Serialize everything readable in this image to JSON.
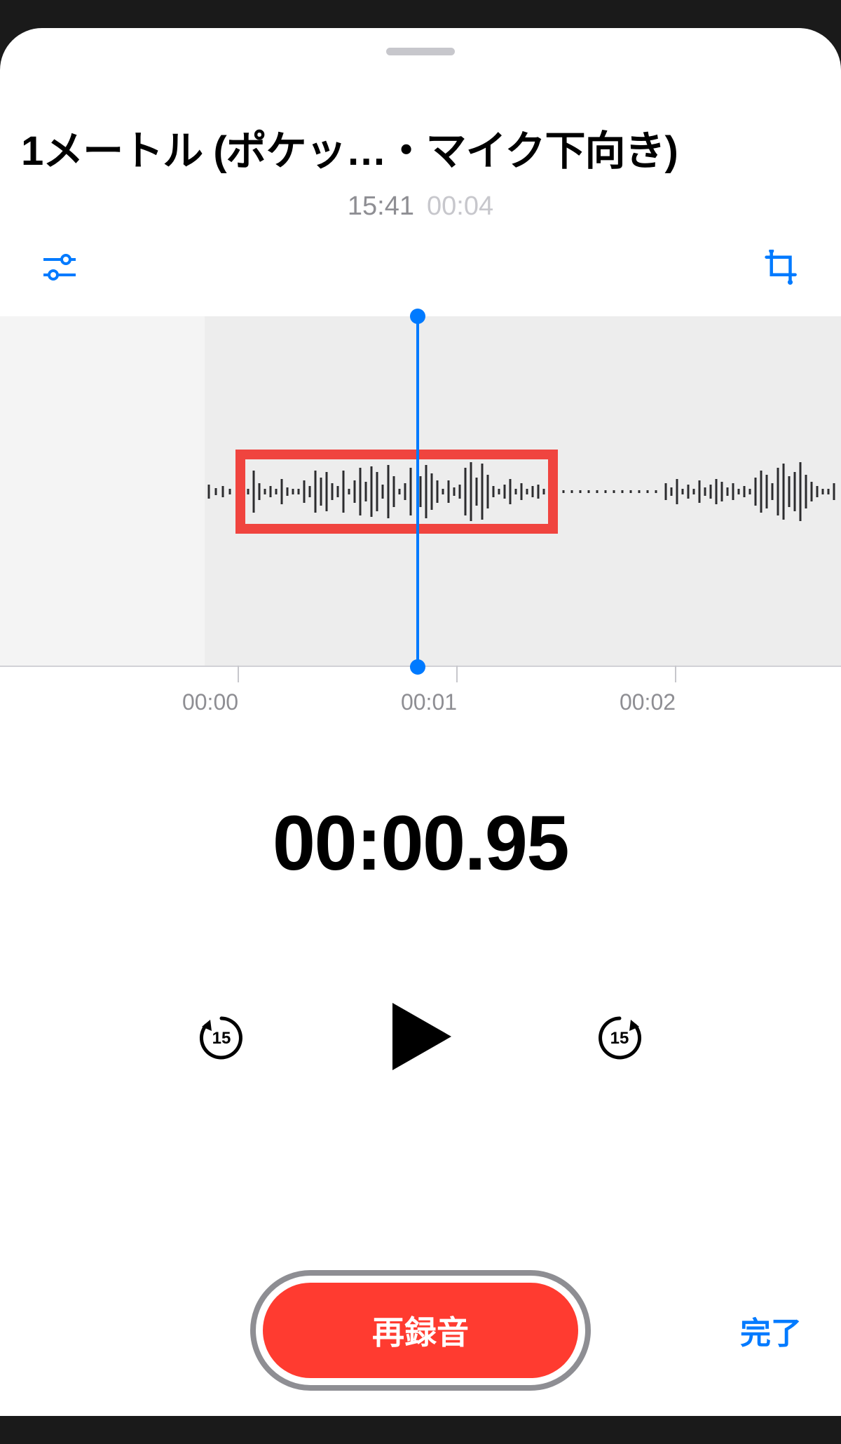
{
  "header": {
    "title": "1メートル (ポケッ…・マイク下向き)",
    "time_recorded": "15:41",
    "duration": "00:04"
  },
  "ruler": {
    "labels": [
      "00:00",
      "00:01",
      "00:02"
    ]
  },
  "timer": {
    "display": "00:00.95"
  },
  "controls": {
    "back_seconds": "15",
    "fwd_seconds": "15"
  },
  "footer": {
    "record_label": "再録音",
    "done_label": "完了"
  },
  "colors": {
    "accent": "#007aff",
    "record": "#ff3b30",
    "highlight": "#f0443f"
  }
}
